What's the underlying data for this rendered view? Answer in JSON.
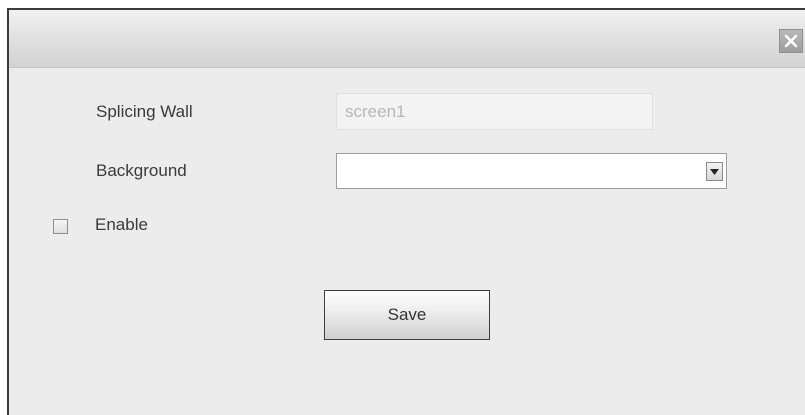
{
  "dialog": {
    "close_icon": "close-icon"
  },
  "form": {
    "splicing_wall_label": "Splicing Wall",
    "splicing_wall_value": "screen1",
    "background_label": "Background",
    "background_value": "",
    "dropdown_icon": "chevron-down-icon",
    "enable_label": "Enable",
    "enable_checked": false
  },
  "buttons": {
    "save_label": "Save"
  }
}
